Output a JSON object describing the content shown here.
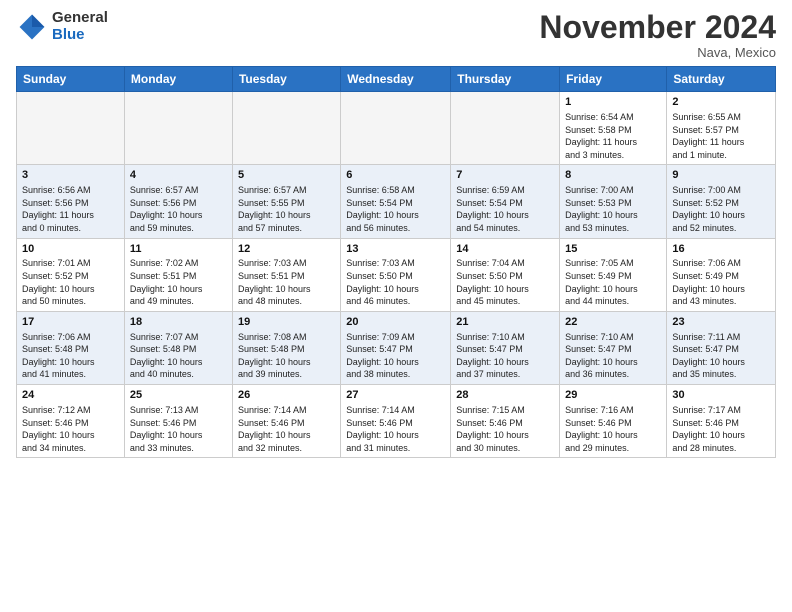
{
  "logo": {
    "general": "General",
    "blue": "Blue"
  },
  "title": "November 2024",
  "subtitle": "Nava, Mexico",
  "headers": [
    "Sunday",
    "Monday",
    "Tuesday",
    "Wednesday",
    "Thursday",
    "Friday",
    "Saturday"
  ],
  "weeks": [
    {
      "alt": false,
      "days": [
        {
          "num": "",
          "info": ""
        },
        {
          "num": "",
          "info": ""
        },
        {
          "num": "",
          "info": ""
        },
        {
          "num": "",
          "info": ""
        },
        {
          "num": "",
          "info": ""
        },
        {
          "num": "1",
          "info": "Sunrise: 6:54 AM\nSunset: 5:58 PM\nDaylight: 11 hours\nand 3 minutes."
        },
        {
          "num": "2",
          "info": "Sunrise: 6:55 AM\nSunset: 5:57 PM\nDaylight: 11 hours\nand 1 minute."
        }
      ]
    },
    {
      "alt": true,
      "days": [
        {
          "num": "3",
          "info": "Sunrise: 6:56 AM\nSunset: 5:56 PM\nDaylight: 11 hours\nand 0 minutes."
        },
        {
          "num": "4",
          "info": "Sunrise: 6:57 AM\nSunset: 5:56 PM\nDaylight: 10 hours\nand 59 minutes."
        },
        {
          "num": "5",
          "info": "Sunrise: 6:57 AM\nSunset: 5:55 PM\nDaylight: 10 hours\nand 57 minutes."
        },
        {
          "num": "6",
          "info": "Sunrise: 6:58 AM\nSunset: 5:54 PM\nDaylight: 10 hours\nand 56 minutes."
        },
        {
          "num": "7",
          "info": "Sunrise: 6:59 AM\nSunset: 5:54 PM\nDaylight: 10 hours\nand 54 minutes."
        },
        {
          "num": "8",
          "info": "Sunrise: 7:00 AM\nSunset: 5:53 PM\nDaylight: 10 hours\nand 53 minutes."
        },
        {
          "num": "9",
          "info": "Sunrise: 7:00 AM\nSunset: 5:52 PM\nDaylight: 10 hours\nand 52 minutes."
        }
      ]
    },
    {
      "alt": false,
      "days": [
        {
          "num": "10",
          "info": "Sunrise: 7:01 AM\nSunset: 5:52 PM\nDaylight: 10 hours\nand 50 minutes."
        },
        {
          "num": "11",
          "info": "Sunrise: 7:02 AM\nSunset: 5:51 PM\nDaylight: 10 hours\nand 49 minutes."
        },
        {
          "num": "12",
          "info": "Sunrise: 7:03 AM\nSunset: 5:51 PM\nDaylight: 10 hours\nand 48 minutes."
        },
        {
          "num": "13",
          "info": "Sunrise: 7:03 AM\nSunset: 5:50 PM\nDaylight: 10 hours\nand 46 minutes."
        },
        {
          "num": "14",
          "info": "Sunrise: 7:04 AM\nSunset: 5:50 PM\nDaylight: 10 hours\nand 45 minutes."
        },
        {
          "num": "15",
          "info": "Sunrise: 7:05 AM\nSunset: 5:49 PM\nDaylight: 10 hours\nand 44 minutes."
        },
        {
          "num": "16",
          "info": "Sunrise: 7:06 AM\nSunset: 5:49 PM\nDaylight: 10 hours\nand 43 minutes."
        }
      ]
    },
    {
      "alt": true,
      "days": [
        {
          "num": "17",
          "info": "Sunrise: 7:06 AM\nSunset: 5:48 PM\nDaylight: 10 hours\nand 41 minutes."
        },
        {
          "num": "18",
          "info": "Sunrise: 7:07 AM\nSunset: 5:48 PM\nDaylight: 10 hours\nand 40 minutes."
        },
        {
          "num": "19",
          "info": "Sunrise: 7:08 AM\nSunset: 5:48 PM\nDaylight: 10 hours\nand 39 minutes."
        },
        {
          "num": "20",
          "info": "Sunrise: 7:09 AM\nSunset: 5:47 PM\nDaylight: 10 hours\nand 38 minutes."
        },
        {
          "num": "21",
          "info": "Sunrise: 7:10 AM\nSunset: 5:47 PM\nDaylight: 10 hours\nand 37 minutes."
        },
        {
          "num": "22",
          "info": "Sunrise: 7:10 AM\nSunset: 5:47 PM\nDaylight: 10 hours\nand 36 minutes."
        },
        {
          "num": "23",
          "info": "Sunrise: 7:11 AM\nSunset: 5:47 PM\nDaylight: 10 hours\nand 35 minutes."
        }
      ]
    },
    {
      "alt": false,
      "days": [
        {
          "num": "24",
          "info": "Sunrise: 7:12 AM\nSunset: 5:46 PM\nDaylight: 10 hours\nand 34 minutes."
        },
        {
          "num": "25",
          "info": "Sunrise: 7:13 AM\nSunset: 5:46 PM\nDaylight: 10 hours\nand 33 minutes."
        },
        {
          "num": "26",
          "info": "Sunrise: 7:14 AM\nSunset: 5:46 PM\nDaylight: 10 hours\nand 32 minutes."
        },
        {
          "num": "27",
          "info": "Sunrise: 7:14 AM\nSunset: 5:46 PM\nDaylight: 10 hours\nand 31 minutes."
        },
        {
          "num": "28",
          "info": "Sunrise: 7:15 AM\nSunset: 5:46 PM\nDaylight: 10 hours\nand 30 minutes."
        },
        {
          "num": "29",
          "info": "Sunrise: 7:16 AM\nSunset: 5:46 PM\nDaylight: 10 hours\nand 29 minutes."
        },
        {
          "num": "30",
          "info": "Sunrise: 7:17 AM\nSunset: 5:46 PM\nDaylight: 10 hours\nand 28 minutes."
        }
      ]
    }
  ]
}
